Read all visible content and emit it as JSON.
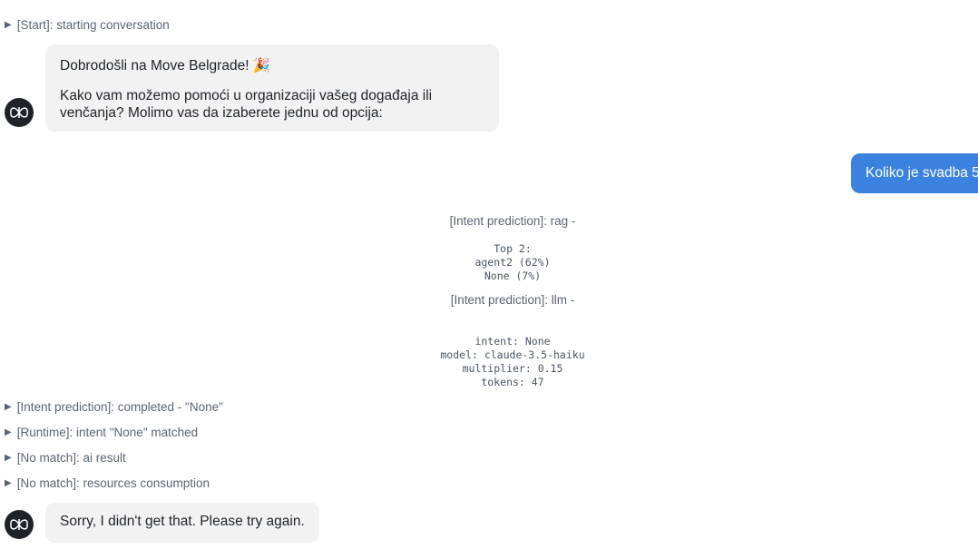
{
  "logs": {
    "start": "[Start]: starting conversation",
    "intent_completed": "[Intent prediction]: completed - \"None\"",
    "runtime": "[Runtime]: intent \"None\" matched",
    "no_match_ai": "[No match]: ai result",
    "no_match_resources": "[No match]: resources consumption"
  },
  "bot_message_1": {
    "line1": "Dobrodošli na Move Belgrade! 🎉",
    "line2": "Kako vam možemo pomoći u organizaciji vašeg događaja ili venčanja? Molimo vas da izaberete jednu od opcija:"
  },
  "user_message": "Koliko je svadba 5",
  "intent_rag": {
    "title": "[Intent prediction]: rag -",
    "lines": [
      "Top 2:",
      "agent2 (62%)",
      "None (7%)"
    ]
  },
  "intent_llm": {
    "title": "[Intent prediction]: llm -",
    "lines": [
      "intent: None",
      "model: claude-3.5-haiku",
      "multiplier: 0.15",
      "tokens: 47"
    ]
  },
  "bot_message_2": "Sorry, I didn't get that. Please try again.",
  "icons": {
    "expand": "triangle-right-icon",
    "avatar": "bot-logo-icon"
  },
  "colors": {
    "user_bubble": "#3b82e0",
    "bot_bubble": "#f2f2f3",
    "avatar_bg": "#1f2328"
  }
}
